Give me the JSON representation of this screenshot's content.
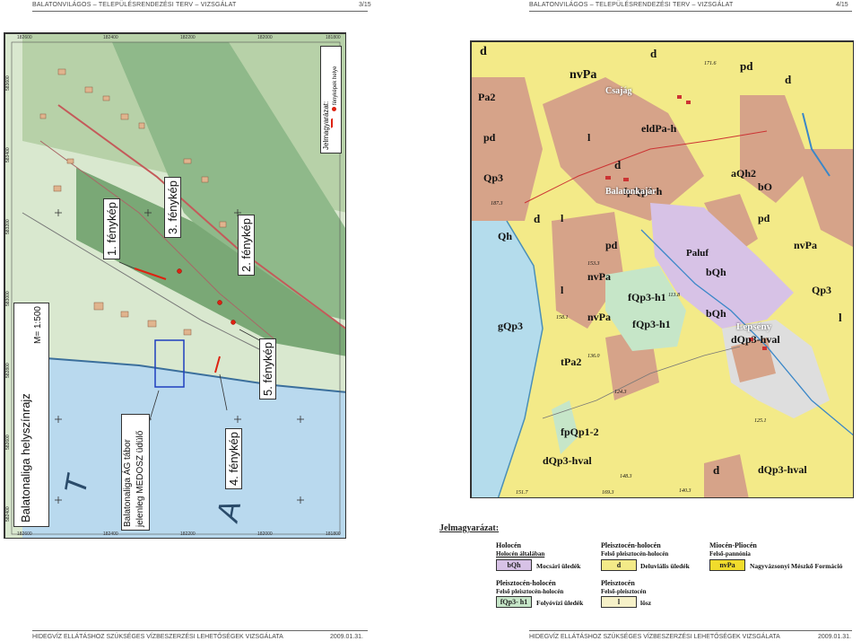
{
  "header": {
    "left_title": "BALATONVILÁGOS – TELEPÜLÉSRENDEZÉSI TERV – VIZSGÁLAT",
    "left_page": "3/15",
    "right_title": "BALATONVILÁGOS – TELEPÜLÉSRENDEZÉSI TERV – VIZSGÁLAT",
    "right_page": "4/15"
  },
  "footer": {
    "left_text": "HIDEGVÍZ ELLÁTÁSHOZ SZÜKSÉGES VÍZBESZERZÉSI LEHETŐSÉGEK VIZSGÁLATA",
    "left_date": "2009.01.31.",
    "right_text": "HIDEGVÍZ ELLÁTÁSHOZ SZÜKSÉGES VÍZBESZERZÉSI LEHETŐSÉGEK VIZSGÁLATA",
    "right_date": "2009.01.31."
  },
  "left_map": {
    "title": "Balatonaliga helyszínrajz",
    "scale": "M= 1:500",
    "photos": [
      "1. fénykép",
      "2. fénykép",
      "3. fénykép",
      "4. fénykép",
      "5. fénykép"
    ],
    "legend_title": "Jelmagyarázat:",
    "legend_item": "fényképek helye",
    "camp_line1": "Balatonaliga ÁG tábor",
    "camp_line2": "jelenleg MEDOSZ üdülő",
    "lake_letters": [
      "T",
      "A"
    ],
    "top_coords": [
      "182600",
      "182400",
      "182200",
      "182000",
      "181800"
    ],
    "bottom_coords": [
      "182600",
      "182400",
      "182200",
      "182000",
      "181800"
    ],
    "side_coords": [
      "583600",
      "583400",
      "583200",
      "583000",
      "582800",
      "582600",
      "582400"
    ]
  },
  "geo_map": {
    "places": [
      "Csajág",
      "Balatonkajár",
      "Lepsény"
    ],
    "elevations": [
      "187.3",
      "153.3",
      "113.8",
      "158.1",
      "136.0",
      "124.3",
      "125.1",
      "148.3",
      "169.3",
      "140.3",
      "151.7",
      "171.6"
    ],
    "units": [
      "d",
      "pd",
      "l",
      "Pa2",
      "nvPa",
      "Qp3",
      "Qh",
      "bQh",
      "fQp3-h1",
      "tPa2",
      "eldPa-h",
      "fpQp3-h",
      "bO",
      "dQp3-hval",
      "fpQp1-2",
      "aQh2",
      "gQp3",
      "Paluf"
    ]
  },
  "legend": {
    "title": "Jelmagyarázat:",
    "holocen": "Holocén",
    "holocen_sub": "Holocén általában",
    "bqh_code": "bQh",
    "bqh_label": "Mocsári üledék",
    "pleisto_holocen_a": "Pleisztocén-holocén",
    "pleisto_holocen_a_sub": "Felső pleisztocén-holocén",
    "d_code": "d",
    "d_label": "Deluviális üledék",
    "miocen": "Miocén-Pliocén",
    "miocen_sub": "Felső-pannónia",
    "nvpa_code": "nvPa",
    "nvpa_label": "Nagyvázsonyi Mészkő Formáció",
    "pleisto_holocen_b": "Pleisztocén-holocén",
    "pleisto_holocen_b_sub": "Felső pleisztocén-holocén",
    "fqp_code": "fQp3- h1",
    "fqp_label": "Folyóvízi üledék",
    "pleisto": "Pleisztocén",
    "pleisto_sub": "Felső-pleisztocén",
    "l_code": "l",
    "l_label": "lösz"
  },
  "colors": {
    "lake": "#b9d9ee",
    "forest": "#8fb98a",
    "geo_yellow": "#f3ea88",
    "geo_pink": "#d6a389",
    "geo_purple": "#d7c2e6",
    "geo_green": "#c6e6c8",
    "geo_blue": "#b4dcec",
    "geo_gray": "#dedede"
  }
}
